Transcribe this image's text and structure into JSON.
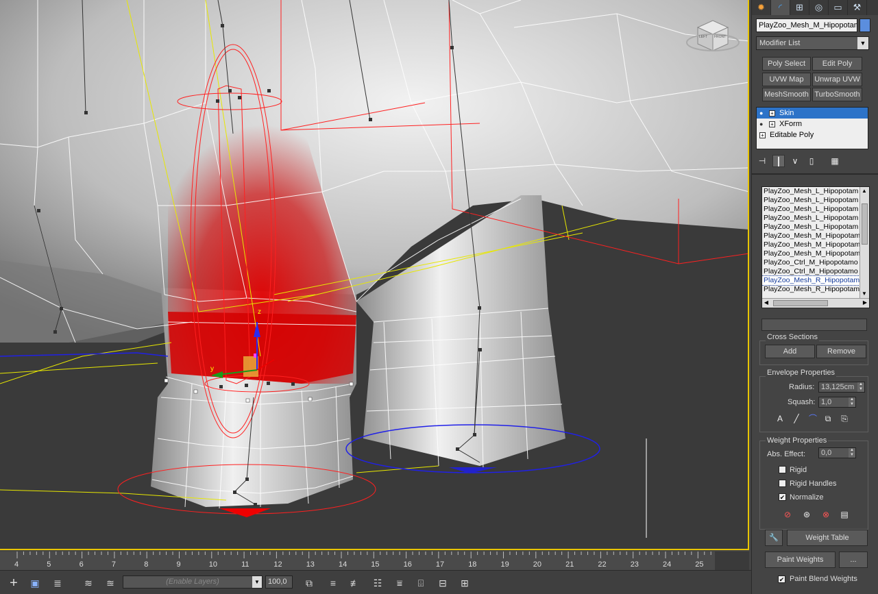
{
  "viewport": {
    "viewcube": {
      "face_top": "LEFT",
      "face_front": "FRONT"
    },
    "axis_labels": {
      "z": "z",
      "y": "y"
    }
  },
  "command_panel": {
    "tabs": [
      "create-icon",
      "modify-icon",
      "hierarchy-icon",
      "motion-icon",
      "display-icon",
      "utilities-icon"
    ],
    "object_name": "PlayZoo_Mesh_M_Hipopotam",
    "object_color": "#5b8ede",
    "modifier_list": "Modifier List",
    "modifier_buttons": [
      "Poly Select",
      "Edit Poly",
      "UVW Map",
      "Unwrap UVW",
      "MeshSmooth",
      "TurboSmooth"
    ],
    "stack": [
      {
        "label": "Skin",
        "selected": true
      },
      {
        "label": "XForm",
        "selected": false
      },
      {
        "label": "Editable Poly",
        "selected": false
      }
    ],
    "bones": [
      "PlayZoo_Mesh_L_Hipopotam",
      "PlayZoo_Mesh_L_Hipopotam",
      "PlayZoo_Mesh_L_Hipopotam",
      "PlayZoo_Mesh_L_Hipopotam",
      "PlayZoo_Mesh_L_Hipopotam",
      "PlayZoo_Mesh_M_Hipopotam",
      "PlayZoo_Mesh_M_Hipopotam",
      "PlayZoo_Mesh_M_Hipopotam",
      "PlayZoo_Ctrl_M_Hipopotamo",
      "PlayZoo_Ctrl_M_Hipopotamo",
      "PlayZoo_Mesh_R_Hipopotam",
      "PlayZoo_Mesh_R_Hipopotam"
    ],
    "selected_bone_index": 10,
    "cross_sections": {
      "title": "Cross Sections",
      "add": "Add",
      "remove": "Remove"
    },
    "envelope_properties": {
      "title": "Envelope Properties",
      "radius_label": "Radius:",
      "radius_value": "13,125cm",
      "squash_label": "Squash:",
      "squash_value": "1,0"
    },
    "weight_properties": {
      "title": "Weight Properties",
      "abs_effect_label": "Abs. Effect:",
      "abs_effect_value": "0,0",
      "rigid": "Rigid",
      "rigid_checked": false,
      "rigid_handles": "Rigid Handles",
      "rigid_handles_checked": false,
      "normalize": "Normalize",
      "normalize_checked": true,
      "weight_table": "Weight Table",
      "paint_weights": "Paint Weights",
      "more": "...",
      "paint_blend_weights": "Paint Blend Weights",
      "paint_blend_checked": true
    }
  },
  "timeline": {
    "ticks": [
      "4",
      "5",
      "6",
      "7",
      "8",
      "9",
      "10",
      "11",
      "12",
      "13",
      "14",
      "15",
      "16",
      "17",
      "18",
      "19",
      "20",
      "21",
      "22",
      "23",
      "24",
      "25"
    ]
  },
  "toolbar": {
    "layer_dropdown": "(Enable Layers)",
    "percent": "100,0"
  }
}
